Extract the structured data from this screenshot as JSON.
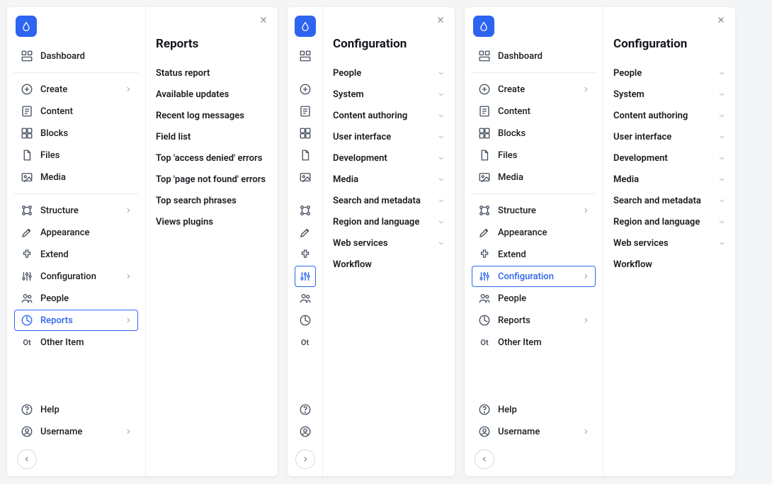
{
  "nav": {
    "dashboard": "Dashboard",
    "create": "Create",
    "content": "Content",
    "blocks": "Blocks",
    "files": "Files",
    "media": "Media",
    "structure": "Structure",
    "appearance": "Appearance",
    "extend": "Extend",
    "configuration": "Configuration",
    "people": "People",
    "reports": "Reports",
    "other": "Other Item",
    "other_abbr": "Ot",
    "help": "Help",
    "username": "Username"
  },
  "panels": {
    "reports": {
      "title": "Reports",
      "items": [
        {
          "label": "Status report",
          "expandable": false
        },
        {
          "label": "Available updates",
          "expandable": false
        },
        {
          "label": "Recent log messages",
          "expandable": false
        },
        {
          "label": "Field list",
          "expandable": false
        },
        {
          "label": "Top 'access denied' errors",
          "expandable": false
        },
        {
          "label": "Top 'page not found' errors",
          "expandable": false
        },
        {
          "label": "Top search phrases",
          "expandable": false
        },
        {
          "label": "Views plugins",
          "expandable": false
        }
      ]
    },
    "configuration": {
      "title": "Configuration",
      "items": [
        {
          "label": "People",
          "expandable": true
        },
        {
          "label": "System",
          "expandable": true
        },
        {
          "label": "Content authoring",
          "expandable": true
        },
        {
          "label": "User interface",
          "expandable": true
        },
        {
          "label": "Development",
          "expandable": true
        },
        {
          "label": "Media",
          "expandable": true
        },
        {
          "label": "Search and metadata",
          "expandable": true
        },
        {
          "label": "Region and language",
          "expandable": true
        },
        {
          "label": "Web services",
          "expandable": true
        },
        {
          "label": "Workflow",
          "expandable": false
        }
      ]
    }
  },
  "variants": [
    {
      "sidebar": "wide",
      "active": "reports",
      "panel": "reports",
      "collapse_dir": "left"
    },
    {
      "sidebar": "narrow",
      "active": "configuration",
      "panel": "configuration",
      "collapse_dir": "right"
    },
    {
      "sidebar": "wide",
      "active": "configuration",
      "panel": "configuration",
      "collapse_dir": "left"
    }
  ]
}
